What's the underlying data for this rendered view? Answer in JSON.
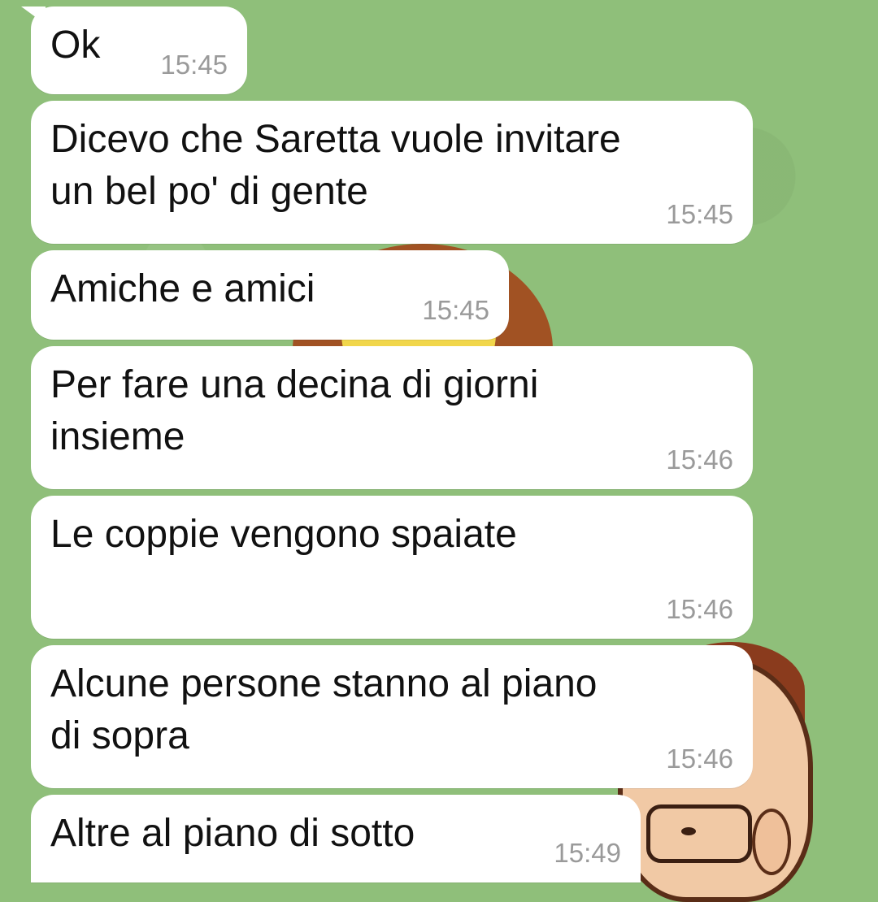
{
  "messages": [
    {
      "text": "Ok",
      "time": "15:45"
    },
    {
      "text": "Dicevo che Saretta vuole invitare\nun bel po' di gente",
      "time": "15:45"
    },
    {
      "text": "Amiche e amici",
      "time": "15:45"
    },
    {
      "text": "Per fare una decina di giorni\ninsieme",
      "time": "15:46"
    },
    {
      "text": "Le coppie vengono spaiate",
      "time": "15:46"
    },
    {
      "text": "Alcune persone stanno al piano\ndi sopra",
      "time": "15:46"
    },
    {
      "text": "Altre al piano di sotto",
      "time": "15:49"
    }
  ]
}
